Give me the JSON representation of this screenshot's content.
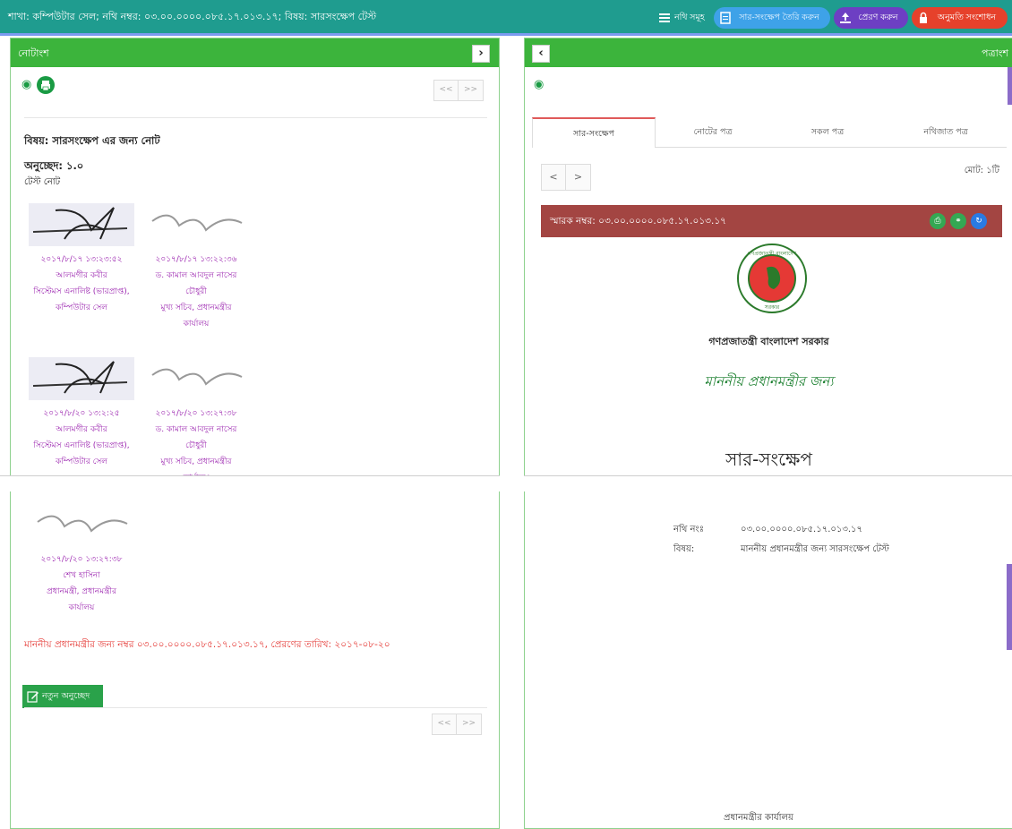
{
  "header": {
    "breadcrumb": "শাখা: কম্পিউটার সেল; নথি নম্বর: ০৩.০০.০০০০.০৮৫.১৭.০১৩.১৭; বিষয়: সারসংক্ষেপ টেস্ট",
    "buttons": [
      {
        "label": "নথি সমূহ",
        "icon": "list-icon"
      },
      {
        "label": "সার-সংক্ষেপ তৈরি করুন",
        "icon": "document-icon"
      },
      {
        "label": "প্রেরণ করুন",
        "icon": "upload-icon"
      },
      {
        "label": "অনুমতি সংশোধন",
        "icon": "lock-icon"
      }
    ]
  },
  "left_panel": {
    "title": "নোটাংশ",
    "pager": [
      "<<",
      ">>"
    ],
    "subject": "বিষয়: সারসংক্ষেপ এর জন্য নোট",
    "paragraph_no": "অনুচ্ছেদ: ১.০",
    "note_text": "টেস্ট নোট",
    "signatures_row1": [
      {
        "date": "২০১৭/৮/১৭ ১৩:২৩:৫২",
        "name": "আলমগীর কবীর",
        "role1": "সিস্টেমস এনালিষ্ট (ভারপ্রাপ্ত),",
        "role2": "কম্পিউটার সেল",
        "role3": ""
      },
      {
        "date": "২০১৭/৮/১৭ ১৩:২২:৩৬",
        "name": "ড. কামাল আবদুল নাসের",
        "role1": "চৌধুরী",
        "role2": "মুখ্য সচিব, প্রধানমন্ত্রীর",
        "role3": "কার্যালয়"
      }
    ],
    "signatures_row2": [
      {
        "date": "২০১৭/৮/২০ ১৩:২:২৫",
        "name": "আলমগীর কবীর",
        "role1": "সিস্টেমস এনালিষ্ট (ভারপ্রাপ্ত),",
        "role2": "কম্পিউটার সেল",
        "role3": ""
      },
      {
        "date": "২০১৭/৮/২০ ১৩:২৭:৩৮",
        "name": "ড. কামাল আবদুল নাসের",
        "role1": "চৌধুরী",
        "role2": "মুখ্য সচিব, প্রধানমন্ত্রীর",
        "role3": "কার্যালয়"
      }
    ],
    "signature_last": {
      "date": "২০১৭/৮/২০ ১৩:২৭:৩৮",
      "name": "শেখ হাসিনা",
      "role1": "প্রধানমন্ত্রী, প্রধানমন্ত্রীর",
      "role2": "কার্যালয়"
    },
    "sent_info": "মাননীয় প্রধানমন্ত্রীর জন্য নম্বর ০৩.০০.০০০০.০৮৫.১৭.০১৩.১৭, প্রেরণের তারিখ: ২০১৭-০৮-২০",
    "new_paragraph_button": "নতুন অনুচ্ছেদ"
  },
  "right_panel": {
    "title": "পত্রাংশ",
    "tabs": [
      "সার-সংক্ষেপ",
      "নোটের পত্র",
      "সকল পত্র",
      "নথিজাত পত্র"
    ],
    "total": "মোট: ১টি",
    "memo_label": "স্মারক নম্বর:  ০৩.০০.০০০০.০৮৫.১৭.০১৩.১৭",
    "seal_text": "গণপ্রজাতন্ত্রী বাংলাদেশ সরকার",
    "seal_top": "গণপ্রজাতন্ত্রী বাংলাদেশ",
    "seal_bottom": "সরকার",
    "org": "গণপ্রজাতন্ত্রী বাংলাদেশ সরকার",
    "for_text": "মাননীয় প্রধানমন্ত্রীর জন্য",
    "doc_title": "সার-সংক্ষেপ",
    "file_no_label": "নথি নংঃ",
    "file_no_value": "০৩.০০.০০০০.০৮৫.১৭.০১৩.১৭",
    "subject_label": "বিষয়:",
    "subject_value": "মাননীয় প্রধানমন্ত্রীর জন্য সারসংক্ষেপ টেস্ট",
    "office": "প্রধানমন্ত্রীর কার্যালয়"
  },
  "colors": {
    "header": "#1f9c8f",
    "panel_header": "#3cb43c",
    "memo_bar": "#a34542",
    "signature": "#9c27b0",
    "sent_info": "#e53935"
  }
}
